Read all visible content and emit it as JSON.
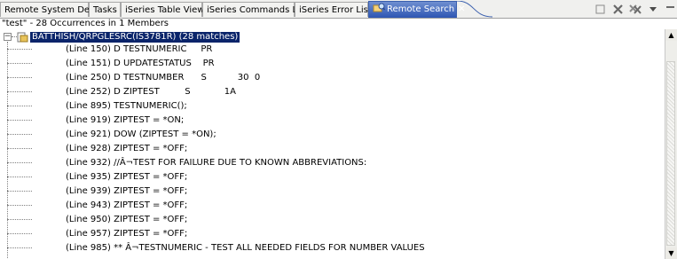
{
  "tabs": [
    {
      "label": "Remote System Details"
    },
    {
      "label": "Tasks"
    },
    {
      "label": "iSeries Table View"
    },
    {
      "label": "iSeries Commands Log"
    },
    {
      "label": "iSeries Error List"
    },
    {
      "label": "Remote Search",
      "close": "✕",
      "active": true
    }
  ],
  "toolbar": {
    "icons": [
      "stop-icon",
      "remove-icon",
      "remove-all-icon",
      "view-menu-icon",
      "minimize-icon"
    ]
  },
  "summary": "\"test\" - 28 Occurrences in 1 Members",
  "root": {
    "label": "BATTHISH/QRPGLESRC(IS3781R) (28 matches)",
    "expander": "−"
  },
  "results": [
    "(Line 150) D TESTNUMERIC     PR",
    "(Line 151) D UPDATESTATUS    PR",
    "(Line 250) D TESTNUMBER      S           30  0",
    "(Line 252) D ZIPTEST         S            1A",
    "(Line 895) TESTNUMERIC();",
    "(Line 919) ZIPTEST = *ON;",
    "(Line 921) DOW (ZIPTEST = *ON);",
    "(Line 928) ZIPTEST = *OFF;",
    "(Line 932) //Â¬TEST FOR FAILURE DUE TO KNOWN ABBREVIATIONS:",
    "(Line 935) ZIPTEST = *OFF;",
    "(Line 939) ZIPTEST = *OFF;",
    "(Line 943) ZIPTEST = *OFF;",
    "(Line 950) ZIPTEST = *OFF;",
    "(Line 957) ZIPTEST = *OFF;",
    "(Line 985) ** Â¬TESTNUMERIC - TEST ALL NEEDED FIELDS FOR NUMBER VALUES"
  ],
  "scrollbar": {
    "up": "▲",
    "down": "▼"
  }
}
